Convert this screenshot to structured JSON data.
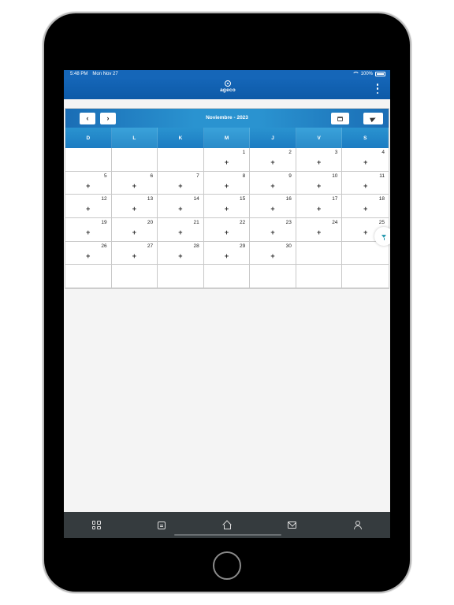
{
  "status_bar": {
    "time": "5:48 PM",
    "date": "Mon Nov 27",
    "battery": "100%"
  },
  "app_bar": {
    "logo_text": "ageco"
  },
  "calendar": {
    "month_label": "Noviembre - 2023",
    "prev_label": "‹",
    "next_label": "›",
    "weekdays": [
      "D",
      "L",
      "K",
      "M",
      "J",
      "V",
      "S"
    ],
    "add_label": "+",
    "days": [
      "",
      "",
      "",
      "1",
      "2",
      "3",
      "4",
      "5",
      "6",
      "7",
      "8",
      "9",
      "10",
      "11",
      "12",
      "13",
      "14",
      "15",
      "16",
      "17",
      "18",
      "19",
      "20",
      "21",
      "22",
      "23",
      "24",
      "25",
      "26",
      "27",
      "28",
      "29",
      "30",
      "",
      "",
      "",
      "",
      "",
      "",
      "",
      "",
      ""
    ]
  },
  "bottom_nav": {
    "items": [
      "grid-icon",
      "note-icon",
      "home-icon",
      "mail-icon",
      "user-icon"
    ]
  },
  "colors": {
    "appbar": "#1566b8",
    "calendar_header": "#2a93d0",
    "bottom_nav": "#353b3e",
    "filter_accent": "#2a9bb0"
  }
}
